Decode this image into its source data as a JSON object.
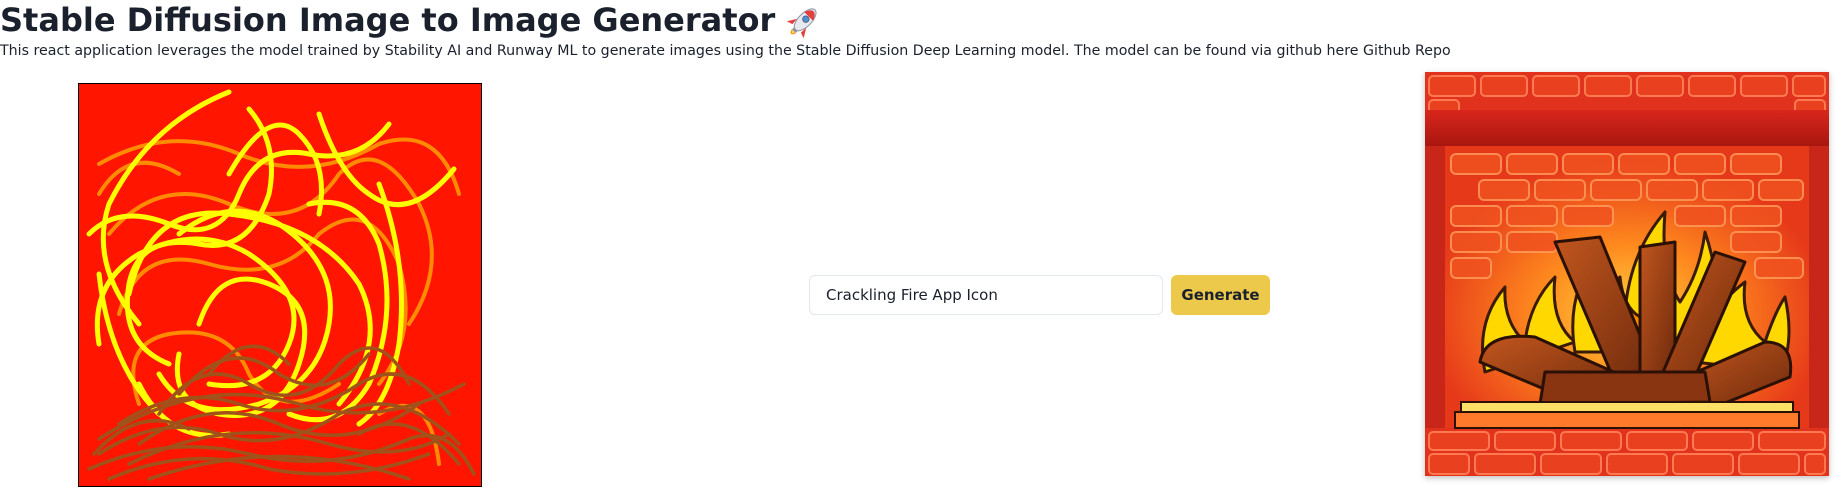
{
  "header": {
    "title": "Stable Diffusion Image to Image Generator",
    "title_emoji_icon": "rocket-icon",
    "description": "This react application leverages the model trained by Stability AI and Runway ML to generate images using the Stable Diffusion Deep Learning model. The model can be found via github here ",
    "description_link": "Github Repo"
  },
  "sketch_canvas": {
    "background_color": "#ff1500",
    "stroke_colors": [
      "#ffff00",
      "#ff8c00",
      "#a0521a"
    ]
  },
  "prompt": {
    "value": "Crackling Fire App Icon",
    "placeholder": "Enter a prompt"
  },
  "generate_button": {
    "label": "Generate",
    "color": "#ecc94b"
  },
  "result_image": {
    "subject": "fireplace with flames and logs"
  }
}
